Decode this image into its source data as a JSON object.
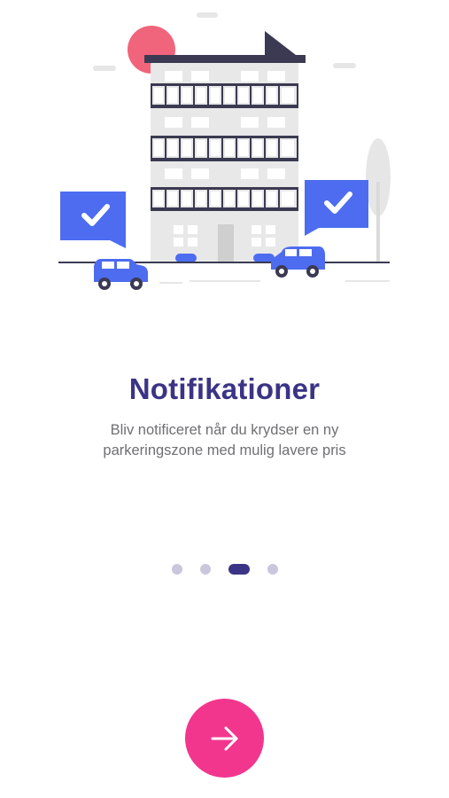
{
  "onboarding": {
    "title": "Notifikationer",
    "description": "Bliv notificeret når du krydser en ny parkeringszone med mulig lavere pris",
    "page_count": 4,
    "active_page": 3
  },
  "next_button": {
    "icon": "arrow-right-icon",
    "color": "#f2368e"
  },
  "colors": {
    "accent": "#f2368e",
    "title": "#3b3486",
    "car_blue": "#4d6cf0",
    "building_gray": "#e8e8e8"
  }
}
